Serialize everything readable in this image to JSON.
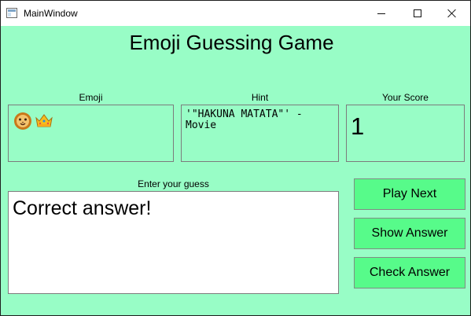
{
  "window": {
    "title": "MainWindow",
    "icons": [
      "application-icon",
      "minimize-icon",
      "maximize-icon",
      "close-icon"
    ]
  },
  "app": {
    "title": "Emoji Guessing Game"
  },
  "emoji_panel": {
    "label": "Emoji",
    "emojis": [
      "lion-face",
      "crown"
    ]
  },
  "hint_panel": {
    "label": "Hint",
    "text": "'\"HAKUNA MATATA\"' - Movie"
  },
  "score_panel": {
    "label": "Your Score",
    "value": "1"
  },
  "guess_panel": {
    "label": "Enter your guess",
    "value": "Correct answer!"
  },
  "buttons": {
    "play_next": "Play Next",
    "show_answer": "Show Answer",
    "check_answer": "Check Answer"
  },
  "colors": {
    "background": "#98fdc6",
    "button": "#57fb8a",
    "input": "#ffffff"
  }
}
